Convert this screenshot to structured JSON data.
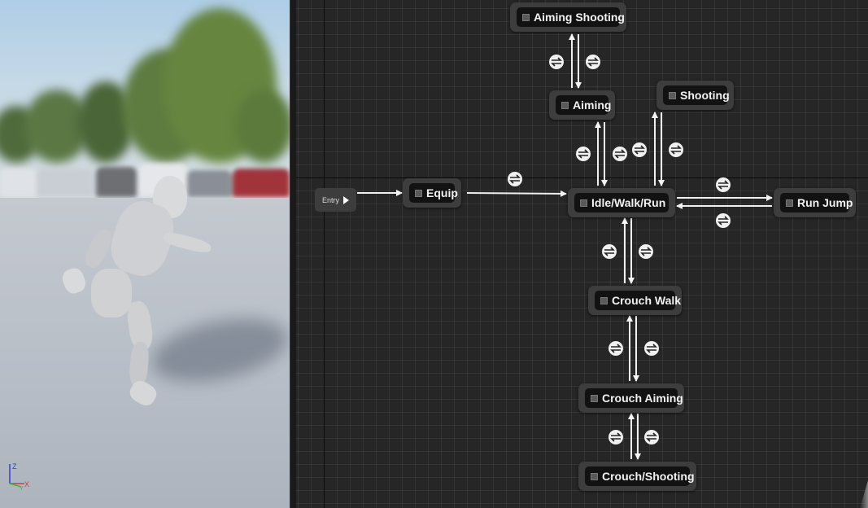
{
  "viewport": {
    "axis_labels": {
      "z": "Z",
      "x": "X",
      "y": "Y"
    },
    "colors": {
      "z_axis": "#3340c8",
      "x_axis": "#d23a3a",
      "y_axis": "#3fb44a"
    }
  },
  "graph": {
    "entry": {
      "label": "Entry"
    },
    "states": [
      {
        "id": "aiming-shooting",
        "label": "Aiming Shooting"
      },
      {
        "id": "aiming",
        "label": "Aiming"
      },
      {
        "id": "shooting",
        "label": "Shooting"
      },
      {
        "id": "equip",
        "label": "Equip"
      },
      {
        "id": "idle-walk-run",
        "label": "Idle/Walk/Run"
      },
      {
        "id": "run-jump",
        "label": "Run Jump"
      },
      {
        "id": "crouch-walk",
        "label": "Crouch Walk"
      },
      {
        "id": "crouch-aiming",
        "label": "Crouch Aiming"
      },
      {
        "id": "crouch-shooting",
        "label": "Crouch/Shooting"
      }
    ],
    "transitions": [
      {
        "from": "Entry",
        "to": "Equip",
        "has_rule": false
      },
      {
        "from": "Equip",
        "to": "Idle/Walk/Run",
        "has_rule": true
      },
      {
        "from": "Idle/Walk/Run",
        "to": "Aiming",
        "has_rule": true
      },
      {
        "from": "Aiming",
        "to": "Idle/Walk/Run",
        "has_rule": true
      },
      {
        "from": "Aiming",
        "to": "Aiming Shooting",
        "has_rule": true
      },
      {
        "from": "Aiming Shooting",
        "to": "Aiming",
        "has_rule": true
      },
      {
        "from": "Idle/Walk/Run",
        "to": "Shooting",
        "has_rule": true
      },
      {
        "from": "Shooting",
        "to": "Idle/Walk/Run",
        "has_rule": true
      },
      {
        "from": "Idle/Walk/Run",
        "to": "Run Jump",
        "has_rule": true
      },
      {
        "from": "Run Jump",
        "to": "Idle/Walk/Run",
        "has_rule": true
      },
      {
        "from": "Idle/Walk/Run",
        "to": "Crouch Walk",
        "has_rule": true
      },
      {
        "from": "Crouch Walk",
        "to": "Idle/Walk/Run",
        "has_rule": true
      },
      {
        "from": "Crouch Walk",
        "to": "Crouch Aiming",
        "has_rule": true
      },
      {
        "from": "Crouch Aiming",
        "to": "Crouch Walk",
        "has_rule": true
      },
      {
        "from": "Crouch Aiming",
        "to": "Crouch/Shooting",
        "has_rule": true
      },
      {
        "from": "Crouch/Shooting",
        "to": "Crouch Aiming",
        "has_rule": true
      }
    ]
  }
}
